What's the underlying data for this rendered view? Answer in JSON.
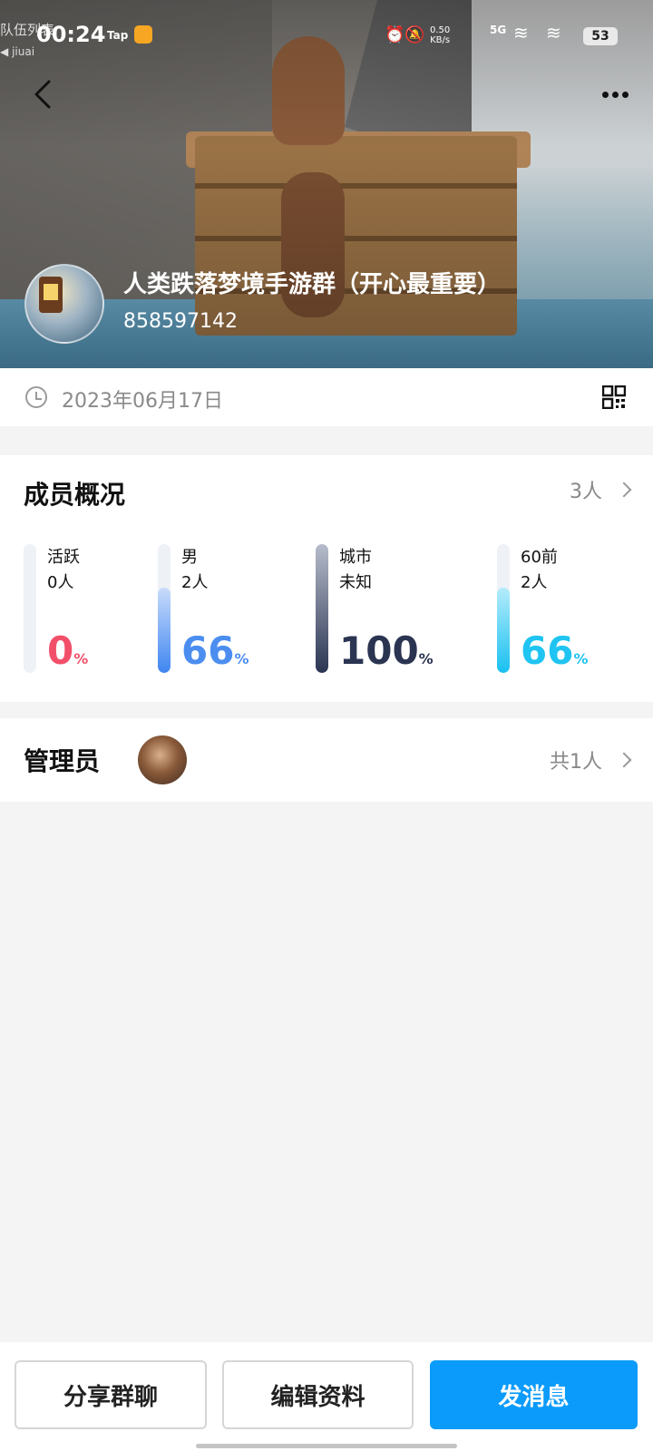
{
  "status_bar": {
    "time": "00:24",
    "tap_label": "Tap",
    "net_speed_value": "0.50",
    "net_speed_unit": "KB/s",
    "network_type": "5G",
    "battery": "53"
  },
  "game_overlay": {
    "team_list": "队伍列表",
    "voice_user": "jiuai"
  },
  "header": {
    "group_name": "人类跌落梦境手游群（开心最重要）",
    "group_id": "858597142"
  },
  "info": {
    "created_date": "2023年06月17日"
  },
  "members": {
    "title": "成员概况",
    "count_label": "3人",
    "stats": [
      {
        "label": "活跃",
        "value": "0人",
        "percent": "0",
        "color": "#f2506a",
        "fill": "#eef1f6",
        "level": 0
      },
      {
        "label": "男",
        "value": "2人",
        "percent": "66",
        "color": "#4b8ef0",
        "fill": "linear-gradient(180deg,#c9dcfb,#3f86f1)",
        "level": 66
      },
      {
        "label": "城市",
        "value": "未知",
        "percent": "100",
        "color": "#2b3552",
        "fill": "linear-gradient(180deg,#b6bccb,#2b3552)",
        "level": 100
      },
      {
        "label": "60前",
        "value": "2人",
        "percent": "66",
        "color": "#1fc4f2",
        "fill": "linear-gradient(180deg,#b5ecfb,#18c0f1)",
        "level": 66
      }
    ],
    "percent_sign": "%"
  },
  "admin": {
    "title": "管理员",
    "count_label": "共1人"
  },
  "actions": {
    "share": "分享群聊",
    "edit": "编辑资料",
    "send": "发消息"
  },
  "colors": {
    "primary": "#0b9bfb"
  }
}
